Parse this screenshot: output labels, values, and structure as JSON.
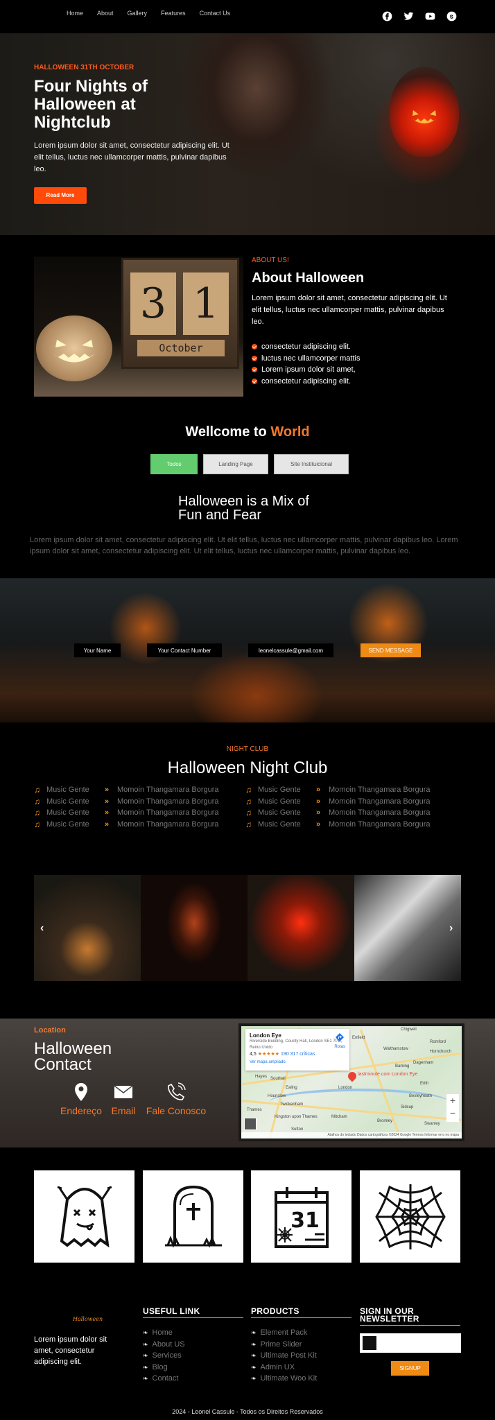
{
  "nav": {
    "links": [
      "Home",
      "About",
      "Gallery",
      "Features",
      "Contact Us"
    ],
    "social_icons": [
      "facebook-icon",
      "twitter-icon",
      "youtube-icon",
      "skype-icon"
    ]
  },
  "hero": {
    "kicker": "HALLOWEEN 31TH OCTOBER",
    "title": "Four Nights of Halloween at Nightclub",
    "text": "Lorem ipsum dolor sit amet, consectetur adipiscing elit. Ut elit tellus, luctus nec ullamcorper mattis, pulvinar dapibus leo.",
    "button": "Read More"
  },
  "about": {
    "calendar_day_1": "3",
    "calendar_day_2": "1",
    "calendar_month": "October",
    "kicker": "ABOUT US!",
    "title": "About Halloween",
    "text": "Lorem ipsum dolor sit amet, consectetur adipiscing elit. Ut elit tellus, luctus nec ullamcorper mattis, pulvinar dapibus leo.",
    "items": [
      "consectetur adipiscing elit.",
      "luctus nec ullamcorper mattis",
      "Lorem ipsum dolor sit amet,",
      "consectetur adipiscing elit."
    ]
  },
  "welcome": {
    "prefix": "Wellcome to",
    "highlight": "World",
    "tabs": [
      "Todos",
      "Landing Page",
      "Site Instituicional"
    ]
  },
  "mix": {
    "title": "Halloween is a Mix of Fun and Fear",
    "text": "Lorem ipsum dolor sit amet, consectetur adipiscing elit. Ut elit tellus, luctus nec ullamcorper mattis, pulvinar dapibus leo. Lorem ipsum dolor sit amet, consectetur adipiscing elit. Ut elit tellus, luctus nec ullamcorper mattis, pulvinar dapibus leo."
  },
  "form": {
    "name_placeholder": "Your Name",
    "contact_placeholder": "Your Contact Number",
    "email_value": "leonelcassule@gmail.com",
    "button": "SEND MESSAGE"
  },
  "nightclub": {
    "kicker": "NIGHT CLUB",
    "title": "Halloween Night Club",
    "music_label": "Music Gente",
    "name_label": "Momoin Thangamara Borgura"
  },
  "gallery": {
    "prev": "‹",
    "next": "›"
  },
  "contact": {
    "kicker": "Location",
    "title": "Halloween Contact",
    "items": [
      "Endereço",
      "Email",
      "Fale Conosco"
    ],
    "map": {
      "place": "London Eye",
      "address": "Riverside Building, County Hall, London SE1 7PB, Reino Unido",
      "rating": "4,5",
      "stars": "★★★★★",
      "reviews": "190 317 críticas",
      "link": "Ver mapa ampliado",
      "directions": "Rotas",
      "pin_label": "lastminute.com London Eye",
      "footer": "Atalhos do teclado   Dados cartográficos ©2024 Google   Termos   Informar erro no mapa",
      "places": [
        "Chigwell",
        "Enfield",
        "Walthamstow",
        "Romford",
        "Hornchurch",
        "Barking",
        "Dagenham",
        "Hayes",
        "Southall",
        "Ealing",
        "London",
        "Erith",
        "Bexleyheath",
        "Sidcup",
        "Hounslow",
        "Twickenham",
        "Kingston upon Thames",
        "Mitcham",
        "Bromley",
        "Swanley",
        "Sutton",
        "Thames"
      ]
    }
  },
  "footer": {
    "logo": "Halloween",
    "text": "Lorem ipsum dolor sit amet, consectetur adipiscing elit.",
    "useful_heading": "USEFUL LINK",
    "useful_links": [
      "Home",
      "About US",
      "Services",
      "Blog",
      "Contact"
    ],
    "products_heading": "PRODUCTS",
    "products": [
      "Element Pack",
      "Prime Slider",
      "Ultimate Post Kit",
      "Admin UX",
      "Ultimate Woo Kit"
    ],
    "newsletter_heading": "SIGN IN OUR NEWSLETTER",
    "signup": "SIGNUP",
    "copyright": "2024 - Leonel Cassule - Todos os Direitos Reservados"
  },
  "tiles": [
    "ghost-icon",
    "tombstone-icon",
    "calendar-31-icon",
    "spiderweb-icon"
  ],
  "tile_calendar_day": "31",
  "colors": {
    "accent": "#f37a2c",
    "hero_accent": "#ff4a0a",
    "tab_active": "#62cc6e",
    "button": "#ef8a14"
  }
}
